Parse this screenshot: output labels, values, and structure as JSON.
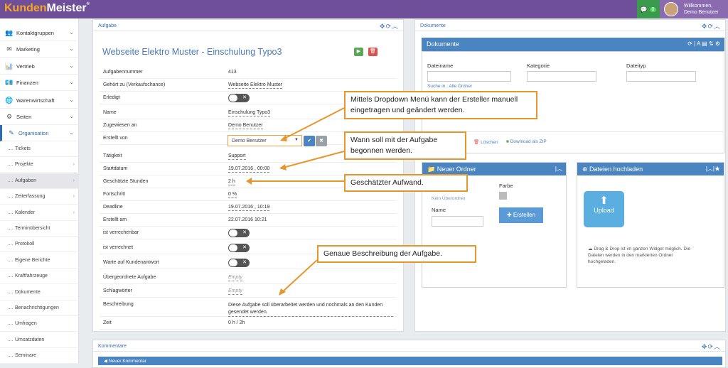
{
  "app": {
    "logo_a": "Kunden",
    "logo_b": "Meister",
    "logo_r": "®",
    "chat_count": "0",
    "welcome_1": "Willkommen,",
    "welcome_2": "Demo Benutzer"
  },
  "sidebar": {
    "items": [
      {
        "label": "Kontaktgruppen",
        "icon": "👥"
      },
      {
        "label": "Marketing",
        "icon": "✉"
      },
      {
        "label": "Vertrieb",
        "icon": "📊"
      },
      {
        "label": "Finanzen",
        "icon": "💶"
      },
      {
        "label": "Warenwirtschaft",
        "icon": "🌐"
      },
      {
        "label": "Seiten",
        "icon": "⚙"
      },
      {
        "label": "Organisation",
        "icon": "✎"
      }
    ],
    "subs": [
      "Tickets",
      "Projekte",
      "Aufgaben",
      "Zeiterfassung",
      "Kalender",
      "Terminübersicht",
      "Protokoll",
      "Eigene Berichte",
      "Kraftfahrzeuge",
      "Dokumente",
      "Benachrichtigungen",
      "Umfragen",
      "Umsatzdaten",
      "Seminare"
    ]
  },
  "task": {
    "panel_title": "Aufgabe",
    "title": "Webseite Elektro Muster - Einschulung Typo3",
    "rows": [
      {
        "label": "Aufgabennummer",
        "value": "413"
      },
      {
        "label": "Gehört zu (Verkaufschance)",
        "value": "Webseite Elektro Muster"
      },
      {
        "label": "Erledigt",
        "value": ""
      },
      {
        "label": "Name",
        "value": "Einschulung Typo3"
      },
      {
        "label": "Zugewiesen an",
        "value": "Demo Benutzer"
      },
      {
        "label": "Erstellt von",
        "value": ""
      },
      {
        "label": "Tätigkeit",
        "value": "Support"
      },
      {
        "label": "Startdatum",
        "value": "19.07.2016 , 00:00"
      },
      {
        "label": "Geschätzte Stunden",
        "value": "2 h"
      },
      {
        "label": "Fortschritt",
        "value": "0 %"
      },
      {
        "label": "Deadline",
        "value": "19.07.2016 , 10:19"
      },
      {
        "label": "Erstellt am",
        "value": "22.07.2016 10:21"
      },
      {
        "label": "ist verrechenbar",
        "value": ""
      },
      {
        "label": "ist verrechnet",
        "value": ""
      },
      {
        "label": "Warte auf Kundenantwort",
        "value": ""
      },
      {
        "label": "Übergeordnete Aufgabe",
        "value": "Empty"
      },
      {
        "label": "Schlagwörter",
        "value": "Empty"
      },
      {
        "label": "Beschreibung",
        "value": "Diese Aufgabe soll überarbeitet werden und nochmals an den Kunden gesendet werden."
      },
      {
        "label": "Zeit",
        "value": "0 h / 2h"
      }
    ],
    "dropdown_value": "Demo Benutzer"
  },
  "callouts": {
    "c1": "Mittels Dropdown Menü kann der Ersteller manuell eingetragen und geändert werden.",
    "c2": "Wann soll mit der Aufgabe begonnen werden.",
    "c3": "Geschätzter Aufwand.",
    "c4": "Genaue Beschreibung der Aufgabe."
  },
  "docs": {
    "panel_title": "Dokumente",
    "bar_title": "Dokumente",
    "col1": "Dateiname",
    "col2": "Kategorie",
    "col3": "Dateityp",
    "search": "Suche in : Alle Ordner",
    "delete": "Löschen",
    "zip": "Download als ZIP",
    "folder_title": "Neuer Ordner",
    "no_parent": "Kein Überordner",
    "color": "Farbe",
    "name": "Name",
    "create": "Erstellen",
    "upload_title": "Dateien hochladen",
    "upload_btn": "Upload",
    "upload_hint": "Drag & Drop ist im ganzen Widget möglich. Die Dateien werden in den markierten Ordner hochgeladen."
  },
  "comments": {
    "panel_title": "Kommentare",
    "new": "Neuer Kommentar"
  },
  "colors": {
    "purple": "#6f4e9a",
    "accent": "#e8962a",
    "blue": "#4a84c1"
  }
}
